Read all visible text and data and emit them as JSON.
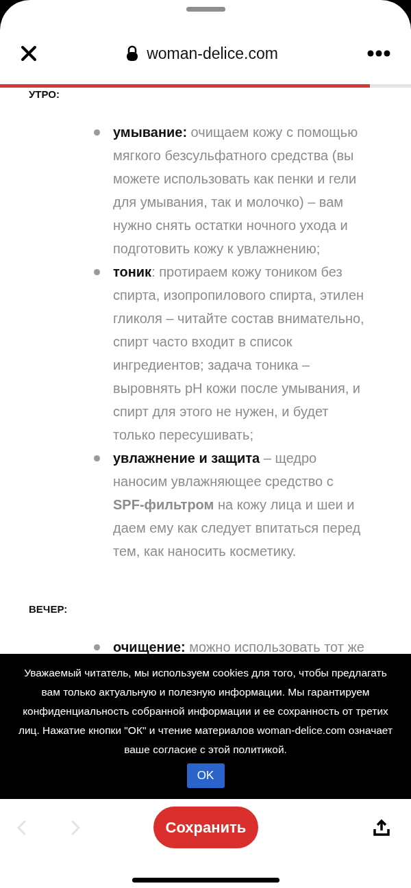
{
  "browser": {
    "url": "woman-delice.com",
    "progress": {
      "level": 0.9
    }
  },
  "sections": [
    {
      "heading": "УТРО:",
      "items": [
        {
          "term": "умывание:",
          "text": " очищаем кожу с помощью мягкого безсульфатного средства (вы можете использовать как пенки и гели для умывания, так и молочко) – вам нужно снять остатки ночного ухода и подготовить кожу к увлажнению;"
        },
        {
          "term": "тоник",
          "text": ": протираем кожу тоником без спирта, изопропилового спирта, этилен гликоля – читайте состав внимательно, спирт часто входит в список ингредиентов; задача тоника – выровнять рН кожи после умывания, и спирт для этого не нужен, и будет только пересушивать;"
        },
        {
          "term": "увлажнение и защита",
          "text": " – щедро наносим увлажняющее средство с **SPF-фильтром** на кожу лица и шеи и даем ему как следует впитаться перед тем, как наносить косметику."
        }
      ]
    },
    {
      "heading": "ВЕЧЕР:",
      "items": [
        {
          "term": "очищение:",
          "text": " можно использовать тот же"
        }
      ]
    }
  ],
  "cookie_banner": {
    "message": "Уважаемый читатель, мы используем cookies для того, чтобы предлагать вам только актуальную и полезную информации. Мы гарантируем конфиденциальность собранной информации и ее сохранность от третих лиц. Нажатие кнопки \"ОК\" и чтение материалов woman-delice.com означает ваше согласие с этой политикой.",
    "button": "OK"
  },
  "toolbar": {
    "back_disabled": true,
    "forward_disabled": true,
    "save_button": "Сохранить"
  }
}
